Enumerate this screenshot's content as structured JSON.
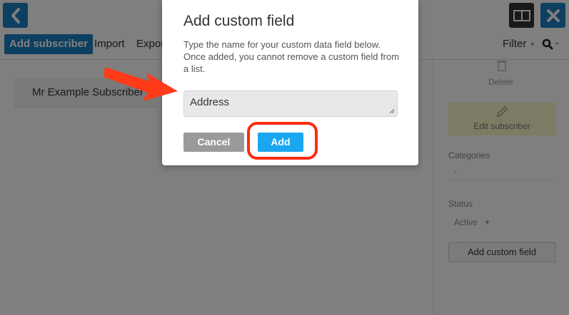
{
  "toolbar": {
    "add_subscriber_label": "Add subscriber",
    "import_label": "Import",
    "export_label": "Expor",
    "filter_label": "Filter"
  },
  "list": {
    "subscriber_name": "Mr Example Subscriber"
  },
  "side_panel": {
    "delete_label": "Delete",
    "edit_label": "Edit subscriber",
    "categories_label": "Categories",
    "categories_value": "-",
    "status_label": "Status",
    "status_value": "Active",
    "add_custom_field_label": "Add custom field"
  },
  "dialog": {
    "title": "Add custom field",
    "description": "Type the name for your custom data field below. Once added, you cannot remove a custom field from a list.",
    "input_value": "Address",
    "cancel_label": "Cancel",
    "add_label": "Add"
  },
  "colors": {
    "primary": "#1a7fc1",
    "add_button": "#1aa7f0",
    "cancel_button": "#9a9a9a",
    "annotation_red": "#ff2a12",
    "edit_highlight": "#fdf6c8"
  },
  "icons": [
    "back-arrow-icon",
    "view-toggle-icon",
    "close-icon",
    "search-icon",
    "trash-icon",
    "pencil-icon",
    "resize-grip-icon",
    "annotation-arrow-icon"
  ]
}
